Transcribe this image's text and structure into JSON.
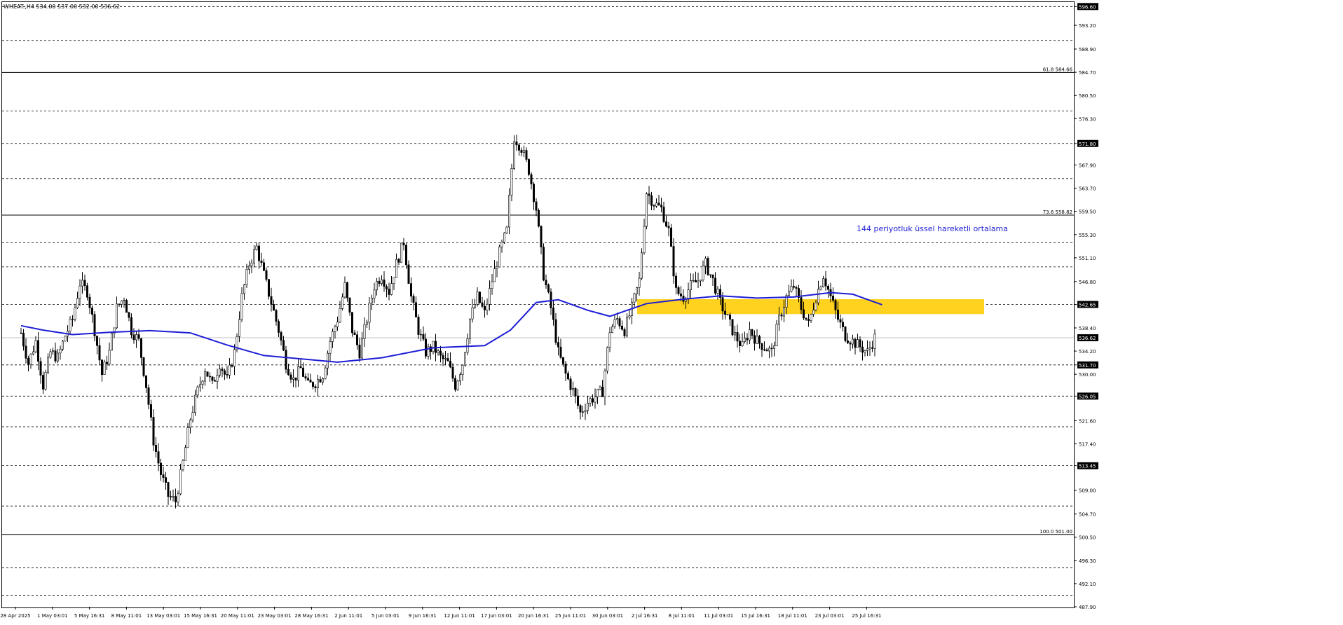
{
  "header": {
    "symbol_info": "WHEAT.,H4 534.00 537.00 532.00 536.62"
  },
  "chart_data": {
    "type": "candlestick",
    "symbol": "WHEAT.",
    "timeframe": "H4",
    "ohlc_header": {
      "open": 534.0,
      "high": 537.0,
      "low": 532.0,
      "close": 536.62
    },
    "ylim": [
      487.9,
      597.4
    ],
    "grid": false,
    "background": "#ffffff",
    "candle_color": "#000000",
    "y_ticks": [
      "596.60",
      "593.20",
      "588.90",
      "584.70",
      "580.50",
      "576.30",
      "571.80",
      "567.90",
      "563.70",
      "559.50",
      "555.30",
      "551.10",
      "546.80",
      "542.65",
      "538.40",
      "534.20",
      "531.70",
      "530.00",
      "526.05",
      "521.60",
      "517.40",
      "513.45",
      "509.00",
      "504.70",
      "500.50",
      "496.30",
      "492.10",
      "487.90"
    ],
    "y_tick_values": [
      596.6,
      593.2,
      588.9,
      584.7,
      580.5,
      576.3,
      571.8,
      567.9,
      563.7,
      559.5,
      555.3,
      551.1,
      546.8,
      542.65,
      538.4,
      534.2,
      531.7,
      530.0,
      526.05,
      521.6,
      517.4,
      513.45,
      509.0,
      504.7,
      500.5,
      496.3,
      492.1,
      487.9
    ],
    "x_ticks": [
      "28 Apr 2025",
      "1 May 03:01",
      "5 May 16:31",
      "8 May 11:01",
      "13 May 03:01",
      "15 May 16:31",
      "20 May 11:01",
      "23 May 03:01",
      "28 May 16:31",
      "2 Jun 11:01",
      "5 Jun 03:01",
      "9 Jun 16:31",
      "12 Jun 11:01",
      "17 Jun 03:01",
      "20 Jun 16:31",
      "25 Jun 11:01",
      "30 Jun 03:01",
      "2 Jul 16:31",
      "8 Jul 11:01",
      "11 Jul 03:01",
      "15 Jul 16:31",
      "18 Jul 11:01",
      "23 Jul 03:01",
      "25 Jul 16:31"
    ],
    "levels": [
      {
        "value": 596.6,
        "label": "596.60",
        "style": "dashed"
      },
      {
        "value": 590.45,
        "label": "590.45",
        "style": "dashed"
      },
      {
        "value": 577.7,
        "label": "577.70",
        "style": "dashed"
      },
      {
        "value": 571.8,
        "label": "571.80",
        "style": "dashed"
      },
      {
        "value": 565.45,
        "label": "565.45",
        "style": "dashed"
      },
      {
        "value": 553.8,
        "label": "553.80",
        "style": "dashed"
      },
      {
        "value": 549.45,
        "label": "549.45",
        "style": "dashed"
      },
      {
        "value": 542.65,
        "label": "542.65",
        "style": "dashed"
      },
      {
        "value": 531.7,
        "label": "531.70",
        "style": "dashed"
      },
      {
        "value": 526.05,
        "label": "526.05",
        "style": "dashed"
      },
      {
        "value": 520.5,
        "label": "520.50",
        "style": "dashed"
      },
      {
        "value": 513.45,
        "label": "513.45",
        "style": "dashed"
      },
      {
        "value": 506.15,
        "label": "506.15",
        "style": "dashed"
      },
      {
        "value": 495.0,
        "label": "495.00",
        "style": "dashed"
      },
      {
        "value": 490.0,
        "label": "490.00",
        "style": "dashed"
      }
    ],
    "fibo_levels": [
      {
        "value": 584.66,
        "label": "61.8 584.66"
      },
      {
        "value": 558.82,
        "label": "73.6 558.82"
      },
      {
        "value": 501.0,
        "label": "100.0 501.00"
      }
    ],
    "current_price": {
      "value": 536.62,
      "label": "536.62"
    },
    "zone": {
      "from": 540.9,
      "to": 543.6,
      "color": "#ffd21f",
      "start_date": "2 Jul 16:31"
    },
    "ema": {
      "label": "144 periyotluk üssel hareketli ortalama",
      "color": "#1d1dd6",
      "period": 144,
      "points": [
        [
          0,
          538.8
        ],
        [
          0.6,
          538.0
        ],
        [
          1.4,
          537.2
        ],
        [
          2.4,
          537.6
        ],
        [
          3.5,
          537.9
        ],
        [
          4.6,
          537.5
        ],
        [
          5.6,
          535.3
        ],
        [
          6.6,
          533.4
        ],
        [
          8.6,
          532.2
        ],
        [
          9.8,
          533.0
        ],
        [
          11.2,
          534.8
        ],
        [
          12.6,
          535.2
        ],
        [
          13.3,
          538.0
        ],
        [
          14.0,
          543.0
        ],
        [
          14.6,
          543.5
        ],
        [
          15.4,
          541.6
        ],
        [
          16.0,
          540.5
        ],
        [
          17.0,
          542.8
        ],
        [
          18.0,
          543.6
        ],
        [
          19.0,
          544.2
        ],
        [
          20.0,
          543.8
        ],
        [
          21.0,
          544.0
        ],
        [
          22.0,
          544.8
        ],
        [
          22.6,
          544.5
        ],
        [
          23.4,
          542.6
        ]
      ]
    },
    "candles": [
      [
        0,
        537.5
      ],
      [
        0.2,
        532.0
      ],
      [
        0.4,
        536.0
      ],
      [
        0.6,
        528.0
      ],
      [
        0.8,
        534.0
      ],
      [
        1.0,
        533.0
      ],
      [
        1.2,
        537.0
      ],
      [
        1.4,
        540.0
      ],
      [
        1.6,
        546.5
      ],
      [
        1.8,
        545.0
      ],
      [
        2.0,
        538.0
      ],
      [
        2.2,
        530.0
      ],
      [
        2.4,
        534.0
      ],
      [
        2.6,
        542.0
      ],
      [
        2.8,
        544.0
      ],
      [
        3.0,
        538.0
      ],
      [
        3.2,
        536.0
      ],
      [
        3.4,
        528.0
      ],
      [
        3.6,
        518.0
      ],
      [
        3.8,
        512.0
      ],
      [
        4.0,
        508.0
      ],
      [
        4.2,
        507.0
      ],
      [
        4.4,
        514.0
      ],
      [
        4.6,
        522.0
      ],
      [
        4.8,
        527.0
      ],
      [
        5.0,
        531.0
      ],
      [
        5.2,
        528.0
      ],
      [
        5.4,
        532.0
      ],
      [
        5.6,
        529.0
      ],
      [
        5.8,
        534.0
      ],
      [
        6.0,
        544.0
      ],
      [
        6.2,
        550.0
      ],
      [
        6.4,
        553.0
      ],
      [
        6.6,
        548.0
      ],
      [
        6.8,
        543.0
      ],
      [
        7.0,
        538.0
      ],
      [
        7.2,
        532.0
      ],
      [
        7.4,
        529.0
      ],
      [
        7.6,
        531.0
      ],
      [
        7.8,
        528.0
      ],
      [
        8.0,
        528.5
      ],
      [
        8.2,
        530.0
      ],
      [
        8.4,
        536.0
      ],
      [
        8.6,
        540.0
      ],
      [
        8.8,
        546.0
      ],
      [
        9.0,
        538.0
      ],
      [
        9.2,
        534.0
      ],
      [
        9.4,
        540.0
      ],
      [
        9.6,
        546.0
      ],
      [
        9.8,
        548.0
      ],
      [
        10.0,
        545.0
      ],
      [
        10.2,
        550.0
      ],
      [
        10.4,
        554.0
      ],
      [
        10.6,
        544.0
      ],
      [
        10.8,
        538.0
      ],
      [
        11.0,
        534.0
      ],
      [
        11.2,
        535.0
      ],
      [
        11.4,
        533.0
      ],
      [
        11.6,
        532.0
      ],
      [
        11.8,
        528.0
      ],
      [
        12.0,
        532.0
      ],
      [
        12.2,
        540.0
      ],
      [
        12.4,
        544.0
      ],
      [
        12.6,
        541.0
      ],
      [
        12.8,
        547.0
      ],
      [
        13.0,
        552.0
      ],
      [
        13.2,
        556.0
      ],
      [
        13.4,
        573.0
      ],
      [
        13.6,
        571.0
      ],
      [
        13.8,
        567.0
      ],
      [
        14.0,
        560.0
      ],
      [
        14.2,
        548.0
      ],
      [
        14.4,
        542.0
      ],
      [
        14.6,
        534.0
      ],
      [
        14.8,
        530.0
      ],
      [
        15.0,
        527.0
      ],
      [
        15.2,
        523.0
      ],
      [
        15.4,
        525.0
      ],
      [
        15.6,
        526.0
      ],
      [
        15.8,
        527.0
      ],
      [
        16.0,
        538.0
      ],
      [
        16.2,
        540.0
      ],
      [
        16.4,
        538.0
      ],
      [
        16.6,
        542.0
      ],
      [
        16.8,
        547.0
      ],
      [
        17.0,
        563.0
      ],
      [
        17.2,
        561.0
      ],
      [
        17.4,
        560.0
      ],
      [
        17.6,
        556.0
      ],
      [
        17.8,
        545.0
      ],
      [
        18.0,
        544.0
      ],
      [
        18.2,
        546.0
      ],
      [
        18.4,
        547.0
      ],
      [
        18.6,
        550.0
      ],
      [
        18.8,
        547.0
      ],
      [
        19.0,
        543.0
      ],
      [
        19.2,
        540.0
      ],
      [
        19.4,
        537.0
      ],
      [
        19.6,
        535.0
      ],
      [
        19.8,
        538.0
      ],
      [
        20.0,
        536.0
      ],
      [
        20.2,
        535.0
      ],
      [
        20.4,
        534.0
      ],
      [
        20.6,
        540.0
      ],
      [
        20.8,
        544.0
      ],
      [
        21.0,
        546.0
      ],
      [
        21.2,
        542.0
      ],
      [
        21.4,
        539.0
      ],
      [
        21.6,
        544.0
      ],
      [
        21.8,
        548.0
      ],
      [
        22.0,
        544.0
      ],
      [
        22.2,
        540.0
      ],
      [
        22.4,
        537.0
      ],
      [
        22.6,
        536.0
      ],
      [
        22.8,
        535.0
      ],
      [
        23.0,
        534.0
      ],
      [
        23.2,
        536.62
      ]
    ]
  }
}
